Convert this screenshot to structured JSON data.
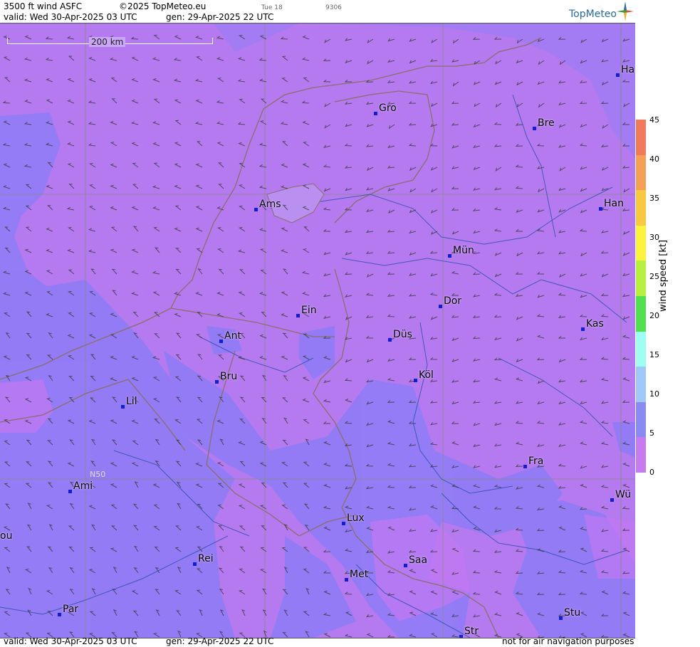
{
  "header": {
    "product": "3500 ft wind ASFC",
    "copyright": "©2025 TopMeteo.eu",
    "day_marker": "Tue 18",
    "code": "9306",
    "valid": "valid:  Wed  30-Apr-2025  03 UTC",
    "generated": "gen: 29-Apr-2025 22 UTC",
    "logo": "TopMeteo"
  },
  "footer": {
    "valid": "valid:  Wed  30-Apr-2025  03 UTC",
    "generated": "gen: 29-Apr-2025 22 UTC",
    "notice": "not for air navigation purposes"
  },
  "map": {
    "scale_label": "200 km",
    "latitude_label": "N50",
    "cities": [
      {
        "key": "ham",
        "label": "Ha"
      },
      {
        "key": "gro",
        "label": "Gro"
      },
      {
        "key": "bre",
        "label": "Bre"
      },
      {
        "key": "ams",
        "label": "Ams"
      },
      {
        "key": "han",
        "label": "Han"
      },
      {
        "key": "mun",
        "label": "Mün"
      },
      {
        "key": "dor",
        "label": "Dor"
      },
      {
        "key": "ein",
        "label": "Ein"
      },
      {
        "key": "kas",
        "label": "Kas"
      },
      {
        "key": "ant",
        "label": "Ant"
      },
      {
        "key": "dus",
        "label": "Düs"
      },
      {
        "key": "bru",
        "label": "Bru"
      },
      {
        "key": "kol",
        "label": "Köl"
      },
      {
        "key": "lil",
        "label": "Lil"
      },
      {
        "key": "fra",
        "label": "Fra"
      },
      {
        "key": "ami",
        "label": "Ami"
      },
      {
        "key": "wur",
        "label": "Wü"
      },
      {
        "key": "lux",
        "label": "Lux"
      },
      {
        "key": "rou",
        "label": "ou"
      },
      {
        "key": "rei",
        "label": "Rei"
      },
      {
        "key": "saa",
        "label": "Saa"
      },
      {
        "key": "met",
        "label": "Met"
      },
      {
        "key": "par",
        "label": "Par"
      },
      {
        "key": "stu",
        "label": "Stu"
      },
      {
        "key": "str",
        "label": "Str"
      }
    ]
  },
  "legend": {
    "unit_label": "wind  speed  [kt]",
    "ticks": [
      "45",
      "40",
      "35",
      "30",
      "25",
      "20",
      "15",
      "10",
      "5",
      "0"
    ],
    "colors": [
      "#f07a5a",
      "#f5a055",
      "#f8c840",
      "#fff23c",
      "#b8f040",
      "#50e050",
      "#9cfff2",
      "#a0c8f8",
      "#8a8af5",
      "#c87af0"
    ]
  },
  "colors": {
    "low_wind": "#b57aef",
    "moderate_wind": "#8f7cf5",
    "border": "#7a6a6a",
    "river": "#2a4fa8"
  }
}
